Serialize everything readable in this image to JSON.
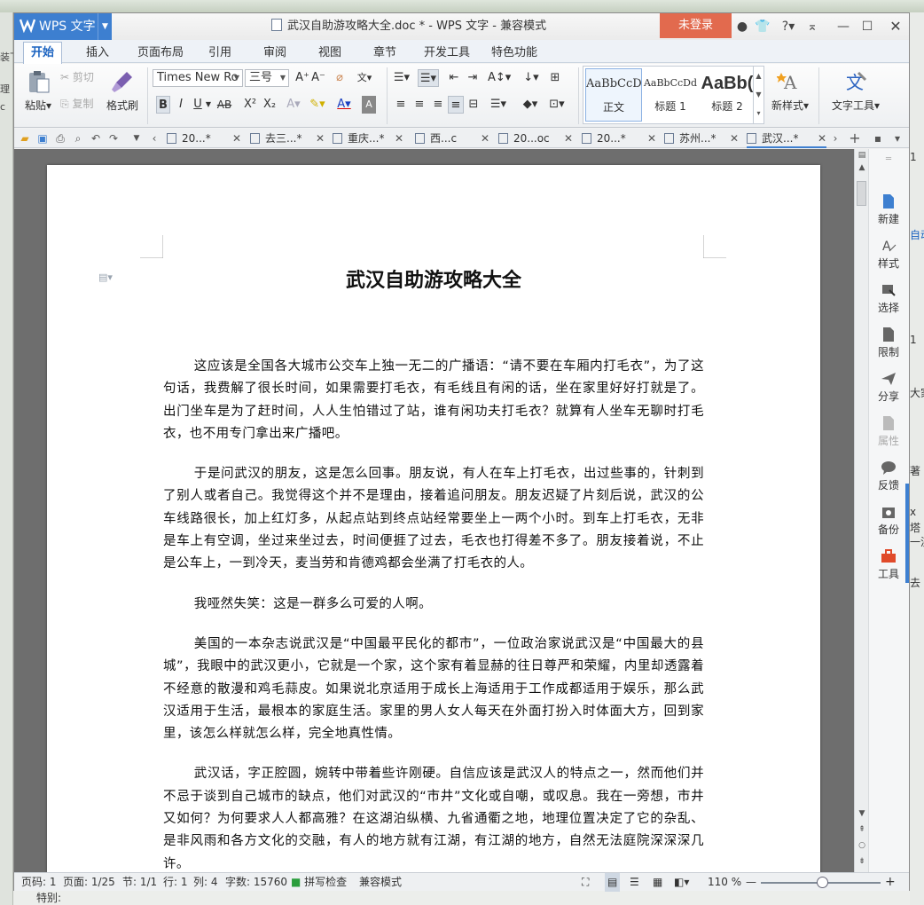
{
  "window": {
    "app_button": "WPS 文字",
    "title": "武汉自助游攻略大全.doc * - WPS 文字 - 兼容模式",
    "login_button": "未登录"
  },
  "ribbon_tabs": [
    "开始",
    "插入",
    "页面布局",
    "引用",
    "审阅",
    "视图",
    "章节",
    "开发工具",
    "特色功能"
  ],
  "ribbon": {
    "paste": "粘贴",
    "cut": "剪切",
    "copy": "复制",
    "format_painter": "格式刷",
    "font_name": "Times New Ro",
    "font_size": "三号",
    "bold": "B",
    "italic": "I",
    "underline": "U",
    "strike": "AB",
    "superscript": "X²",
    "subscript": "X₂",
    "styles": [
      {
        "sample": "AaBbCcD",
        "label": "正文"
      },
      {
        "sample": "AaBbCcDd",
        "label": "标题 1"
      },
      {
        "sample": "AaBb(",
        "label": "标题 2"
      }
    ],
    "new_style": "新样式",
    "text_tools": "文字工具"
  },
  "doc_tabs": [
    {
      "label": "20...*",
      "active": false
    },
    {
      "label": "去三...*",
      "active": false
    },
    {
      "label": "重庆...*",
      "active": false
    },
    {
      "label": "西...c",
      "active": false
    },
    {
      "label": "20...oc",
      "active": false
    },
    {
      "label": "20...*",
      "active": false
    },
    {
      "label": "苏州...*",
      "active": false
    },
    {
      "label": "武汉...*",
      "active": true
    }
  ],
  "document": {
    "title": "武汉自助游攻略大全",
    "paragraphs": [
      "这应该是全国各大城市公交车上独一无二的广播语：“请不要在车厢内打毛衣”，为了这句话，我费解了很长时间，如果需要打毛衣，有毛线且有闲的话，坐在家里好好打就是了。出门坐车是为了赶时间，人人生怕错过了站，谁有闲功夫打毛衣？就算有人坐车无聊时打毛衣，也不用专门拿出来广播吧。",
      "于是问武汉的朋友，这是怎么回事。朋友说，有人在车上打毛衣，出过些事的，针刺到了别人或者自己。我觉得这个并不是理由，接着追问朋友。朋友迟疑了片刻后说，武汉的公车线路很长，加上红灯多，从起点站到终点站经常要坐上一两个小时。到车上打毛衣，无非是车上有空调，坐过来坐过去，时间便捱了过去，毛衣也打得差不多了。朋友接着说，不止是公车上，一到冷天，麦当劳和肯德鸡都会坐满了打毛衣的人。",
      "我哑然失笑：这是一群多么可爱的人啊。",
      "美国的一本杂志说武汉是“中国最平民化的都市”，一位政治家说武汉是“中国最大的县城”，我眼中的武汉更小，它就是一个家，这个家有着显赫的往日尊严和荣耀，内里却透露着不经意的散漫和鸡毛蒜皮。如果说北京适用于成长上海适用于工作成都适用于娱乐，那么武汉适用于生活，最根本的家庭生活。家里的男人女人每天在外面打扮入时体面大方，回到家里，该怎么样就怎么样，完全地真性情。",
      "武汉话，字正腔圆，婉转中带着些许刚硬。自信应该是武汉人的特点之一，然而他们并不忌于谈到自己城市的缺点，他们对武汉的“市井”文化或自嘲，或叹息。我在一旁想，市井又如何？为何要求人人都高雅？在这湖泊纵横、九省通衢之地，地理位置决定了它的杂乱、是非风雨和各方文化的交融，有人的地方就有江湖，有江湖的地方，自然无法庭院深深深几许。"
    ]
  },
  "sidebar": [
    "新建",
    "样式",
    "选择",
    "限制",
    "分享",
    "属性",
    "反馈",
    "备份",
    "工具"
  ],
  "statusbar": {
    "page_code": "页码: 1",
    "page": "页面: 1/25",
    "section": "节: 1/1",
    "row": "行: 1",
    "col": "列: 4",
    "words": "字数: 15760",
    "spell": "拼写检查",
    "compat": "兼容模式",
    "zoom": "110 %",
    "zoom_fraction": 0.52
  },
  "background": {
    "bottom_label": "特别:",
    "left_fragments": [
      "装下",
      "理",
      "c"
    ],
    "right_fragments": [
      "1",
      "自动",
      "1",
      "大家",
      "著",
      "x",
      "塔",
      "一決",
      "去"
    ]
  }
}
